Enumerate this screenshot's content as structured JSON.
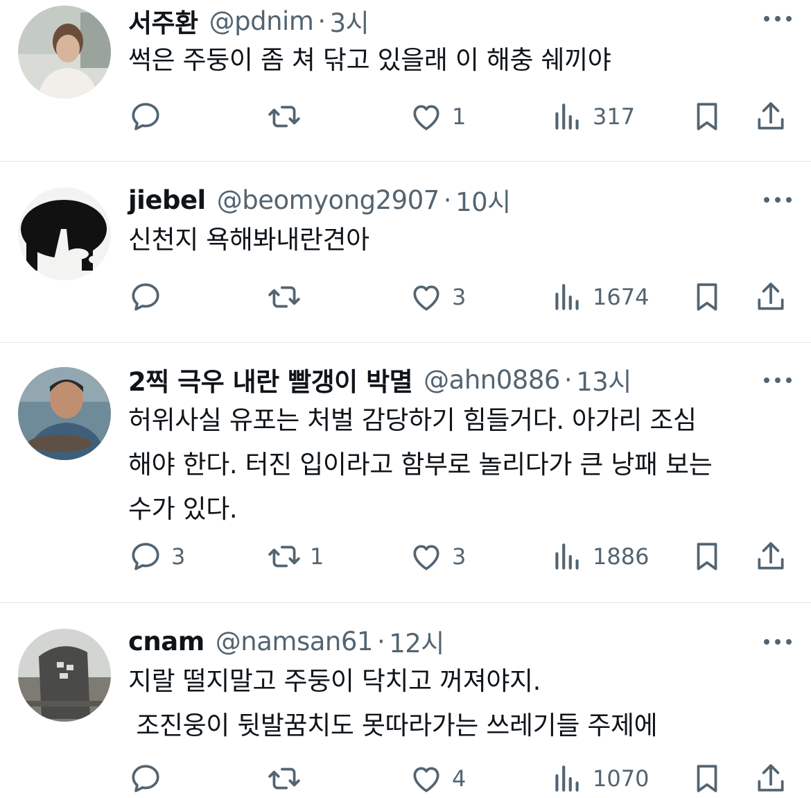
{
  "tweets": [
    {
      "name": "서주환",
      "handle": "@pdnim",
      "dot": "·",
      "time": "3시",
      "lines": [
        "썩은 주둥이 좀 쳐 닦고 있을래 이 해충 쉐끼야"
      ],
      "replies": "",
      "retweets": "",
      "likes": "1",
      "views": "317"
    },
    {
      "name": "jiebel",
      "handle": "@beomyong2907",
      "dot": "·",
      "time": "10시",
      "lines": [
        "신천지 욕해봐내란견아"
      ],
      "replies": "",
      "retweets": "",
      "likes": "3",
      "views": "1674"
    },
    {
      "name": "2찍 극우 내란 빨갱이 박멸",
      "handle": "@ahn0886",
      "dot": "·",
      "time": "13시",
      "lines": [
        "허위사실 유포는 처벌 감당하기 힘들거다. 아가리 조심",
        "해야 한다. 터진 입이라고 함부로 놀리다가 큰 낭패 보는",
        "수가 있다."
      ],
      "replies": "3",
      "retweets": "1",
      "likes": "3",
      "views": "1886"
    },
    {
      "name": "cnam",
      "handle": "@namsan61",
      "dot": "·",
      "time": "12시",
      "lines": [
        "지랄 떨지말고 주둥이 닥치고 꺼져야지.",
        " 조진웅이 뒷발꿈치도 못따라가는 쓰레기들 주제에"
      ],
      "replies": "",
      "retweets": "",
      "likes": "4",
      "views": "1070"
    }
  ],
  "icons": {
    "reply": "reply-icon",
    "retweet": "retweet-icon",
    "like": "heart-icon",
    "views": "views-icon",
    "bookmark": "bookmark-icon",
    "share": "share-icon",
    "more": "more-icon"
  },
  "colors": {
    "text": "#0f1419",
    "secondary": "#536471",
    "divider": "#e1e6ea"
  }
}
